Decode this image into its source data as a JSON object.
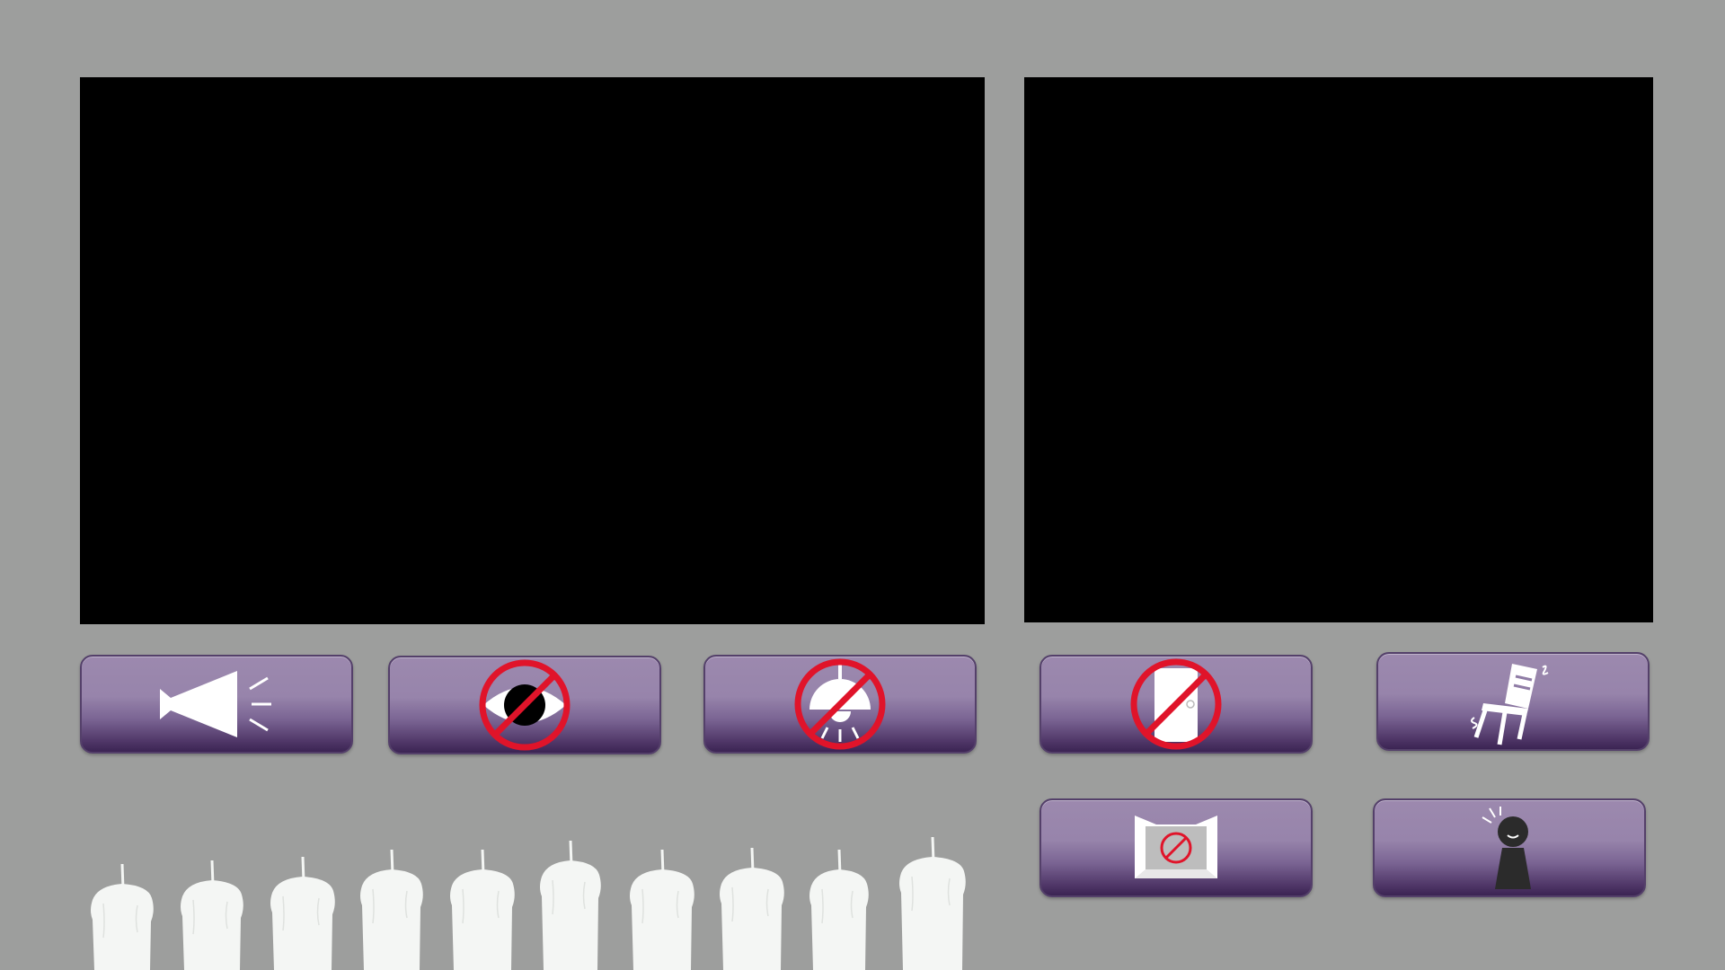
{
  "game": {
    "screens": [
      {
        "id": "left-monitor",
        "content": ""
      },
      {
        "id": "right-monitor",
        "content": ""
      }
    ],
    "action_buttons": [
      {
        "id": "sound",
        "icon": "megaphone-icon"
      },
      {
        "id": "eye",
        "icon": "no-look-icon"
      },
      {
        "id": "lamp",
        "icon": "no-light-icon"
      },
      {
        "id": "door",
        "icon": "no-door-icon"
      },
      {
        "id": "chair",
        "icon": "shaking-chair-icon"
      },
      {
        "id": "box",
        "icon": "blocked-box-icon"
      },
      {
        "id": "person",
        "icon": "startled-person-icon"
      }
    ],
    "candles": {
      "count": 10,
      "lit": 0,
      "icon": "candle-icon"
    }
  },
  "colors": {
    "background": "#9d9e9d",
    "screen": "#000000",
    "button_top": "#9c89ae",
    "button_bottom": "#3b2453",
    "prohibit_red": "#e0142a",
    "icon_white": "#ffffff",
    "candle": "#f4f6f4"
  }
}
